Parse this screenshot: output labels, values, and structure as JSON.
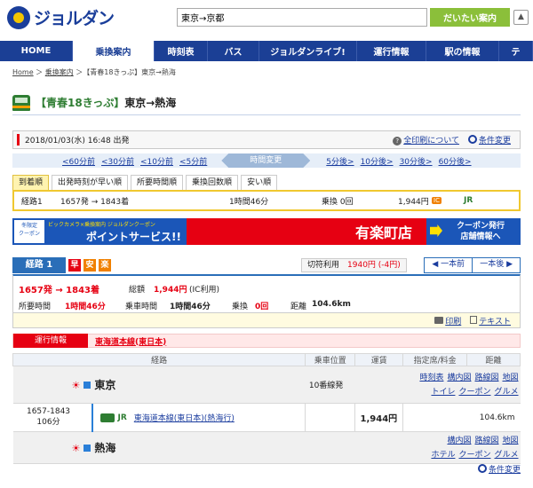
{
  "header": {
    "logo_text": "ジョルダン",
    "search_value": "東京→京都",
    "search_button": "だいたい案内"
  },
  "nav": [
    "HOME",
    "乗換案内",
    "時刻表",
    "バス",
    "ジョルダンライブ!",
    "運行情報",
    "駅の情報",
    "テ"
  ],
  "breadcrumb": {
    "home": "Home",
    "transfer": "乗換案内",
    "current": "【青春18きっぷ】東京→熱海"
  },
  "title": {
    "tag": "【青春18きっぷ】",
    "route": "東京→熱海"
  },
  "datebar": {
    "datetime": "2018/01/03(水) 16:48 出発",
    "print_link": "全印刷について",
    "condition_link": "条件変更"
  },
  "timebar": {
    "minus": [
      "<60分前",
      "<30分前",
      "<10分前",
      "<5分前"
    ],
    "center": "時間変更",
    "plus": [
      "5分後>",
      "10分後>",
      "30分後>",
      "60分後>"
    ]
  },
  "sort_tabs": [
    "到着順",
    "出発時刻が早い順",
    "所要時間順",
    "乗換回数順",
    "安い順"
  ],
  "summary": {
    "label": "経路1",
    "time": "1657発 → 1843着",
    "duration": "1時間46分",
    "transfers": "乗換 0回",
    "fare": "1,944円",
    "ic": "IC",
    "company": "JR"
  },
  "banner": {
    "tag_line1": "冬限定",
    "tag_line2": "クーポン",
    "top": "ビックカメラ×乗換案内 ジョルダンクーポン",
    "point": "ポイントサービス!!",
    "station": "有楽町店",
    "coupon1": "クーポン発行",
    "coupon2": "店舗情報へ"
  },
  "route_tabs": {
    "label": "経路 1",
    "badges": [
      "早",
      "安",
      "楽"
    ],
    "fare_label": "切符利用",
    "fare_value": "1940円 (-4円)",
    "prev": "一本前",
    "next": "一本後"
  },
  "route": {
    "time": "1657発 → 1843着",
    "total_label": "総額",
    "total": "1,944円",
    "ic_note": "(IC利用)",
    "required_label": "所要時間",
    "required": "1時間46分",
    "ride_label": "乗車時間",
    "ride": "1時間46分",
    "transfer_label": "乗換",
    "transfer": "0回",
    "distance_label": "距離",
    "distance": "104.6km"
  },
  "print": {
    "print": "印刷",
    "text": "テキスト"
  },
  "operation": {
    "label": "運行情報",
    "line": "東海道本線(東日本)"
  },
  "table": {
    "headers": [
      "経路",
      "乗車位置",
      "運賃",
      "指定席/料金",
      "距離"
    ],
    "start": {
      "station": "東京",
      "platform": "10番線発",
      "links1": [
        "時刻表",
        "構内図",
        "路線図",
        "地図"
      ],
      "links2": [
        "トイレ",
        "クーポン",
        "グルメ"
      ]
    },
    "segment": {
      "time": "1657-1843",
      "minutes": "106分",
      "company": "JR",
      "line": "東海道本線(東日本)(熱海行)",
      "fare": "1,944円",
      "distance": "104.6km"
    },
    "end": {
      "station": "熱海",
      "links1": [
        "構内図",
        "路線図",
        "地図"
      ],
      "links2": [
        "ホテル",
        "クーポン",
        "グルメ"
      ]
    }
  },
  "bottom_link": "条件変更",
  "colors": {
    "brand": "#1b3f95",
    "accent": "#e60012",
    "highlight": "#f0c830"
  }
}
